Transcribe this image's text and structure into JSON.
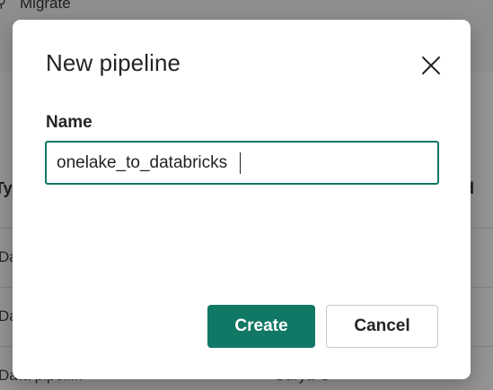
{
  "background": {
    "toolbar": {
      "migrate_label": "Migrate"
    },
    "table": {
      "header_left": "Ty",
      "header_right": "ed",
      "rows": [
        {
          "type": "Da",
          "owner": ""
        },
        {
          "type": "Da",
          "owner": ""
        },
        {
          "type": "Data pipeli...",
          "owner": "Surya C"
        }
      ]
    }
  },
  "dialog": {
    "title": "New pipeline",
    "close_icon": "close-icon",
    "name_field": {
      "label": "Name",
      "value": "onelake_to_databricks"
    },
    "buttons": {
      "create": "Create",
      "cancel": "Cancel"
    }
  },
  "colors": {
    "accent": "#117865",
    "overlay": "rgba(0,0,0,0.42)"
  }
}
